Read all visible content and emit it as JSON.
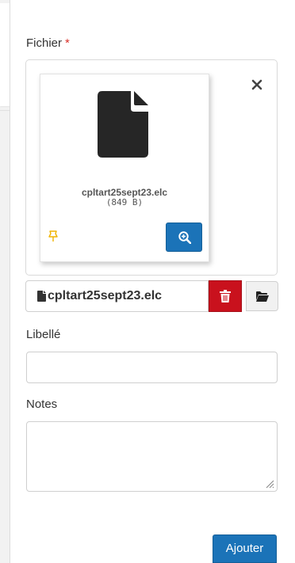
{
  "form": {
    "fichier_label": "Fichier",
    "required_marker": "*",
    "libelle_label": "Libellé",
    "libelle_value": "",
    "notes_label": "Notes",
    "notes_value": "",
    "submit_label": "Ajouter"
  },
  "preview": {
    "file_name": "cpltart25sept23.elc",
    "file_size": "(849 B)",
    "close_symbol": "×"
  },
  "file_input": {
    "file_name": "cpltart25sept23.elc"
  },
  "icons": {
    "document": "file-icon",
    "zoom": "zoom-in-icon",
    "pin": "thumbtack-icon",
    "delete": "trash-icon",
    "browse": "folder-open-icon",
    "close": "close-icon"
  },
  "colors": {
    "primary": "#1b73b8",
    "danger": "#c9111d",
    "required": "#d9322b",
    "pin": "#f0b400",
    "icon_dark": "#262626"
  }
}
